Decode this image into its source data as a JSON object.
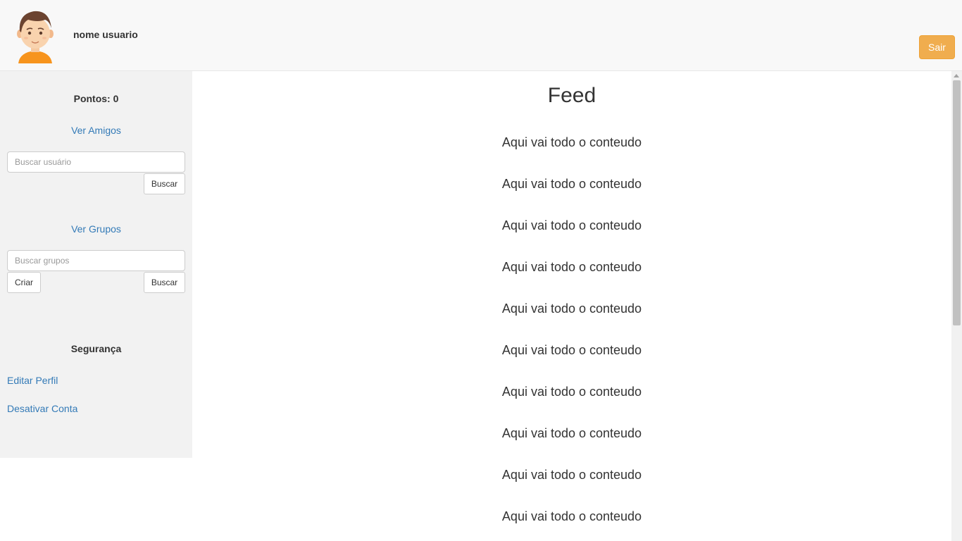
{
  "header": {
    "username": "nome usuario",
    "logout_label": "Sair",
    "logout_color": "#f0ad4e"
  },
  "sidebar": {
    "points_label": "Pontos: 0",
    "friends_link": "Ver Amigos",
    "user_search_placeholder": "Buscar usuário",
    "user_search_button": "Buscar",
    "groups_link": "Ver Grupos",
    "group_search_placeholder": "Buscar grupos",
    "create_group_button": "Criar",
    "group_search_button": "Buscar",
    "security_heading": "Segurança",
    "edit_profile_link": "Editar Perfil",
    "deactivate_account_link": "Desativar Conta"
  },
  "feed": {
    "title": "Feed",
    "items": [
      "Aqui vai todo o conteudo",
      "Aqui vai todo o conteudo",
      "Aqui vai todo o conteudo",
      "Aqui vai todo o conteudo",
      "Aqui vai todo o conteudo",
      "Aqui vai todo o conteudo",
      "Aqui vai todo o conteudo",
      "Aqui vai todo o conteudo",
      "Aqui vai todo o conteudo",
      "Aqui vai todo o conteudo"
    ]
  },
  "colors": {
    "link": "#337ab7",
    "sidebar_bg": "#f2f2f2",
    "header_bg": "#f8f8f8"
  }
}
